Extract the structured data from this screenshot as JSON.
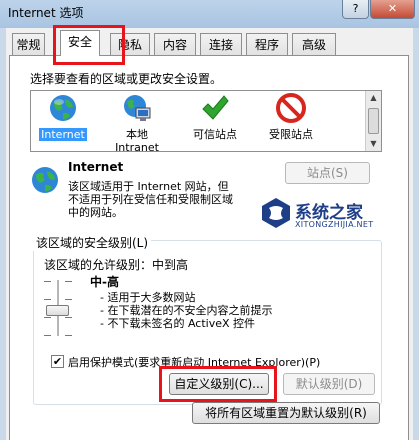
{
  "window": {
    "title": "Internet 选项",
    "help_label": "?",
    "close_label": "✕"
  },
  "tabs": [
    {
      "label": "常规",
      "active": false
    },
    {
      "label": "安全",
      "active": true
    },
    {
      "label": "隐私",
      "active": false
    },
    {
      "label": "内容",
      "active": false
    },
    {
      "label": "连接",
      "active": false
    },
    {
      "label": "程序",
      "active": false
    },
    {
      "label": "高级",
      "active": false
    }
  ],
  "security": {
    "zone_prompt": "选择要查看的区域或更改安全设置。",
    "zones": [
      {
        "line1": "Internet",
        "line2": "",
        "icon": "globe-icon",
        "selected": true
      },
      {
        "line1": "本地",
        "line2": "Intranet",
        "icon": "local-intranet-icon",
        "selected": false
      },
      {
        "line1": "可信站点",
        "line2": "",
        "icon": "check-icon",
        "selected": false
      },
      {
        "line1": "受限站点",
        "line2": "",
        "icon": "no-entry-icon",
        "selected": false
      }
    ],
    "zone_name": "Internet",
    "sites_button": "站点(S)",
    "zone_description_lines": [
      "该区域适用于 Internet 网站，但",
      "不适用于列在受信任和受限制区域",
      "中的网站。"
    ],
    "level_group_title": "该区域的安全级别(L)",
    "allowed_levels_text": "该区域的允许级别：中到高",
    "level_name": "中-高",
    "level_bullets": [
      "- 适用于大多数网站",
      "- 在下载潜在的不安全内容之前提示",
      "- 不下载未签名的 ActiveX 控件"
    ],
    "slider_level_index": 2,
    "slider_level_count": 4,
    "protected_mode_checked": true,
    "protected_mode_label": "启用保护模式(要求重新启动 Internet Explorer)(P)",
    "custom_level_button": "自定义级别(C)...",
    "default_level_button": "默认级别(D)",
    "reset_all_button": "将所有区域重置为默认级别(R)"
  },
  "watermark": {
    "text": "系统之家",
    "url": "XITONGZHIJIA.NET"
  },
  "colors": {
    "highlight_red": "#e8141b",
    "selection_blue": "#3399ff"
  }
}
